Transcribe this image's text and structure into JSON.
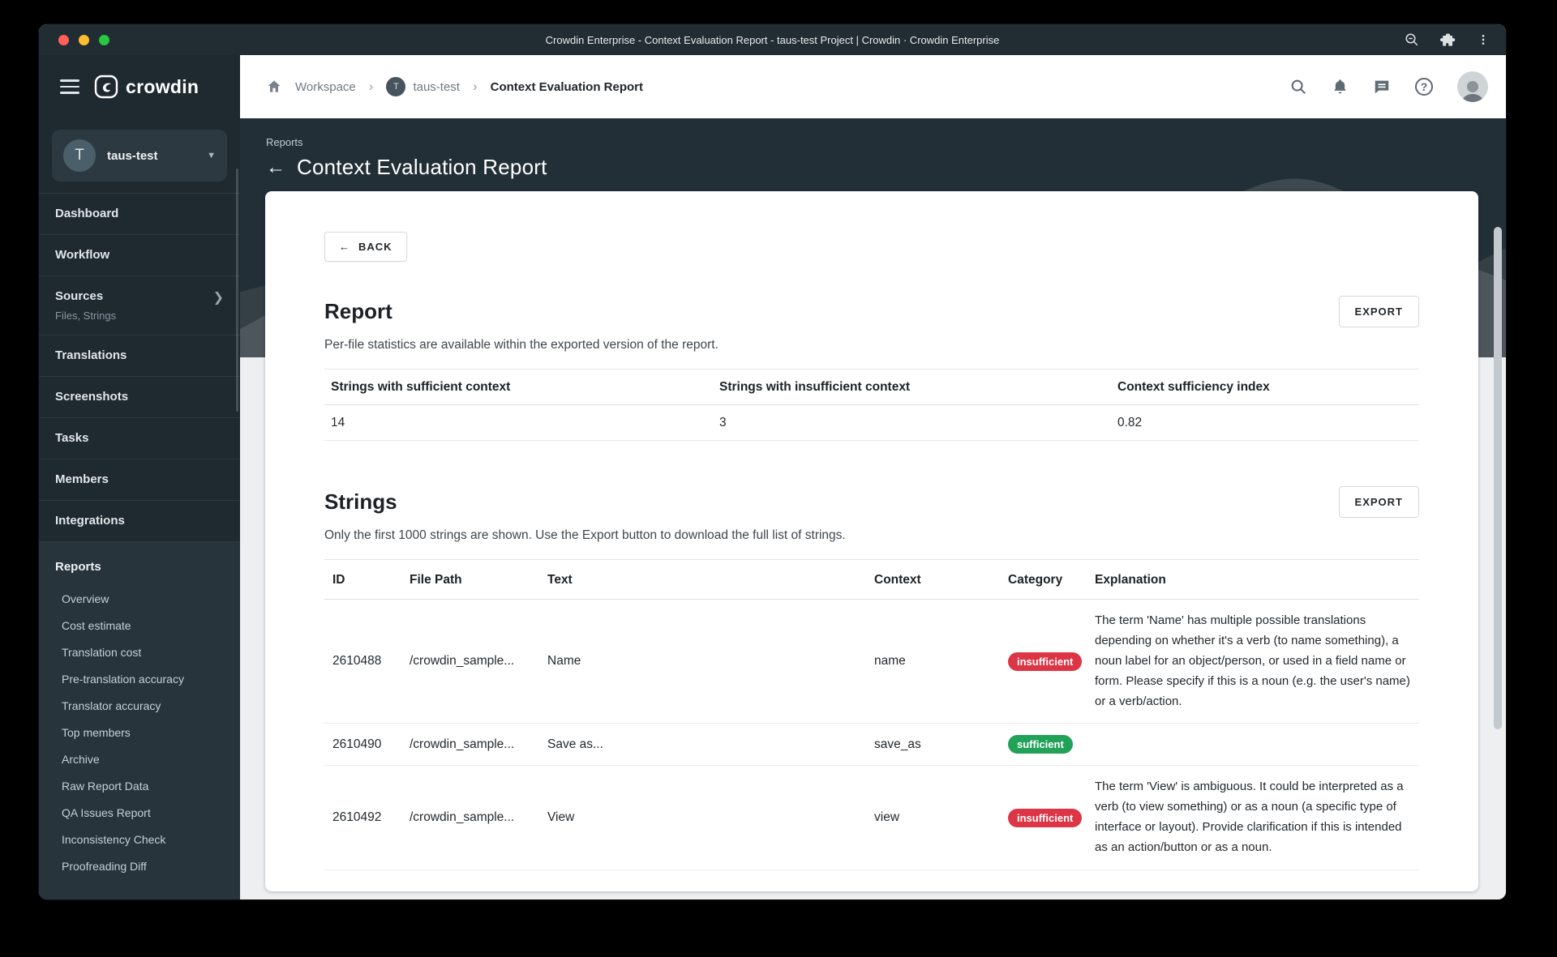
{
  "browser": {
    "title": "Crowdin Enterprise - Context Evaluation Report - taus-test Project | Crowdin · Crowdin Enterprise"
  },
  "brand": {
    "logo_text": "crowdin"
  },
  "breadcrumb": {
    "workspace": "Workspace",
    "project": "taus-test",
    "project_initial": "T",
    "page": "Context Evaluation Report"
  },
  "sidebar": {
    "project_name": "taus-test",
    "project_initial": "T",
    "items": [
      {
        "label": "Dashboard"
      },
      {
        "label": "Workflow"
      },
      {
        "label": "Sources",
        "sublabel": "Files, Strings"
      },
      {
        "label": "Translations"
      },
      {
        "label": "Screenshots"
      },
      {
        "label": "Tasks"
      },
      {
        "label": "Members"
      },
      {
        "label": "Integrations"
      }
    ],
    "reports_label": "Reports",
    "reports_items": [
      {
        "label": "Overview"
      },
      {
        "label": "Cost estimate"
      },
      {
        "label": "Translation cost"
      },
      {
        "label": "Pre-translation accuracy"
      },
      {
        "label": "Translator accuracy"
      },
      {
        "label": "Top members"
      },
      {
        "label": "Archive"
      },
      {
        "label": "Raw Report Data"
      },
      {
        "label": "QA Issues Report"
      },
      {
        "label": "Inconsistency Check"
      },
      {
        "label": "Proofreading Diff"
      }
    ]
  },
  "hero": {
    "eyebrow": "Reports",
    "title": "Context Evaluation Report",
    "back_arrow": "←"
  },
  "toolbar": {
    "back_label": "BACK",
    "back_arrow": "←"
  },
  "report": {
    "title": "Report",
    "subtitle": "Per-file statistics are available within the exported version of the report.",
    "export_label": "EXPORT",
    "stats_headers": [
      "Strings with sufficient context",
      "Strings with insufficient context",
      "Context sufficiency index"
    ],
    "stats_values": [
      "14",
      "3",
      "0.82"
    ]
  },
  "strings": {
    "title": "Strings",
    "subtitle": "Only the first 1000 strings are shown. Use the Export button to download the full list of strings.",
    "export_label": "EXPORT",
    "columns": [
      "ID",
      "File Path",
      "Text",
      "Context",
      "Category",
      "Explanation"
    ],
    "rows": [
      {
        "id": "2610488",
        "file_path": "/crowdin_sample...",
        "text": "Name",
        "context": "name",
        "category": "insufficient",
        "explanation": "The term 'Name' has multiple possible translations depending on whether it's a verb (to name something), a noun label for an object/person, or used in a field name or form. Please specify if this is a noun (e.g. the user's name) or a verb/action."
      },
      {
        "id": "2610490",
        "file_path": "/crowdin_sample...",
        "text": "Save as...",
        "context": "save_as",
        "category": "sufficient",
        "explanation": ""
      },
      {
        "id": "2610492",
        "file_path": "/crowdin_sample...",
        "text": "View",
        "context": "view",
        "category": "insufficient",
        "explanation": "The term 'View' is ambiguous. It could be interpreted as a verb (to view something) or as a noun (a specific type of interface or layout). Provide clarification if this is intended as an action/button or as a noun."
      }
    ]
  },
  "colors": {
    "insufficient": "#dc3545",
    "sufficient": "#22a159",
    "accent_dark": "#232f37"
  }
}
